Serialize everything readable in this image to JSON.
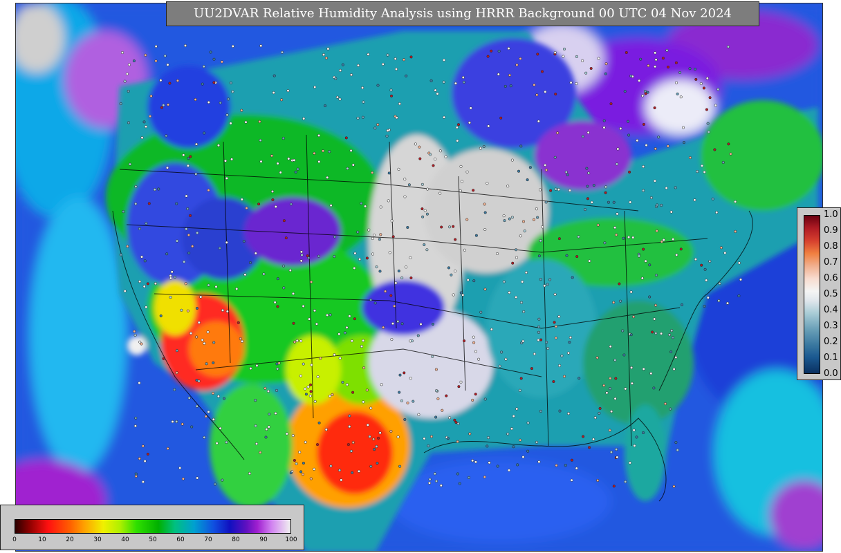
{
  "title": "UU2DVAR Relative Humidity Analysis using HRRR Background 00 UTC 04 Nov 2024",
  "colors": {
    "ocean_base": "#2458e0",
    "land_missing": "#cfcfcf",
    "dry_red": "#ff2020",
    "orange": "#ffa000",
    "yellow": "#f0f000",
    "green": "#10c020",
    "teal": "#1aa0a0",
    "cyan": "#20c0e0",
    "purple": "#8a2bd0",
    "white": "#f0f0f0"
  },
  "rh_legend": {
    "ticks": [
      "0",
      "10",
      "20",
      "30",
      "40",
      "50",
      "60",
      "70",
      "80",
      "90",
      "100"
    ]
  },
  "error_legend": {
    "ticks": [
      "1.0",
      "0.9",
      "0.8",
      "0.7",
      "0.6",
      "0.5",
      "0.4",
      "0.3",
      "0.2",
      "0.1",
      "0.0"
    ]
  }
}
